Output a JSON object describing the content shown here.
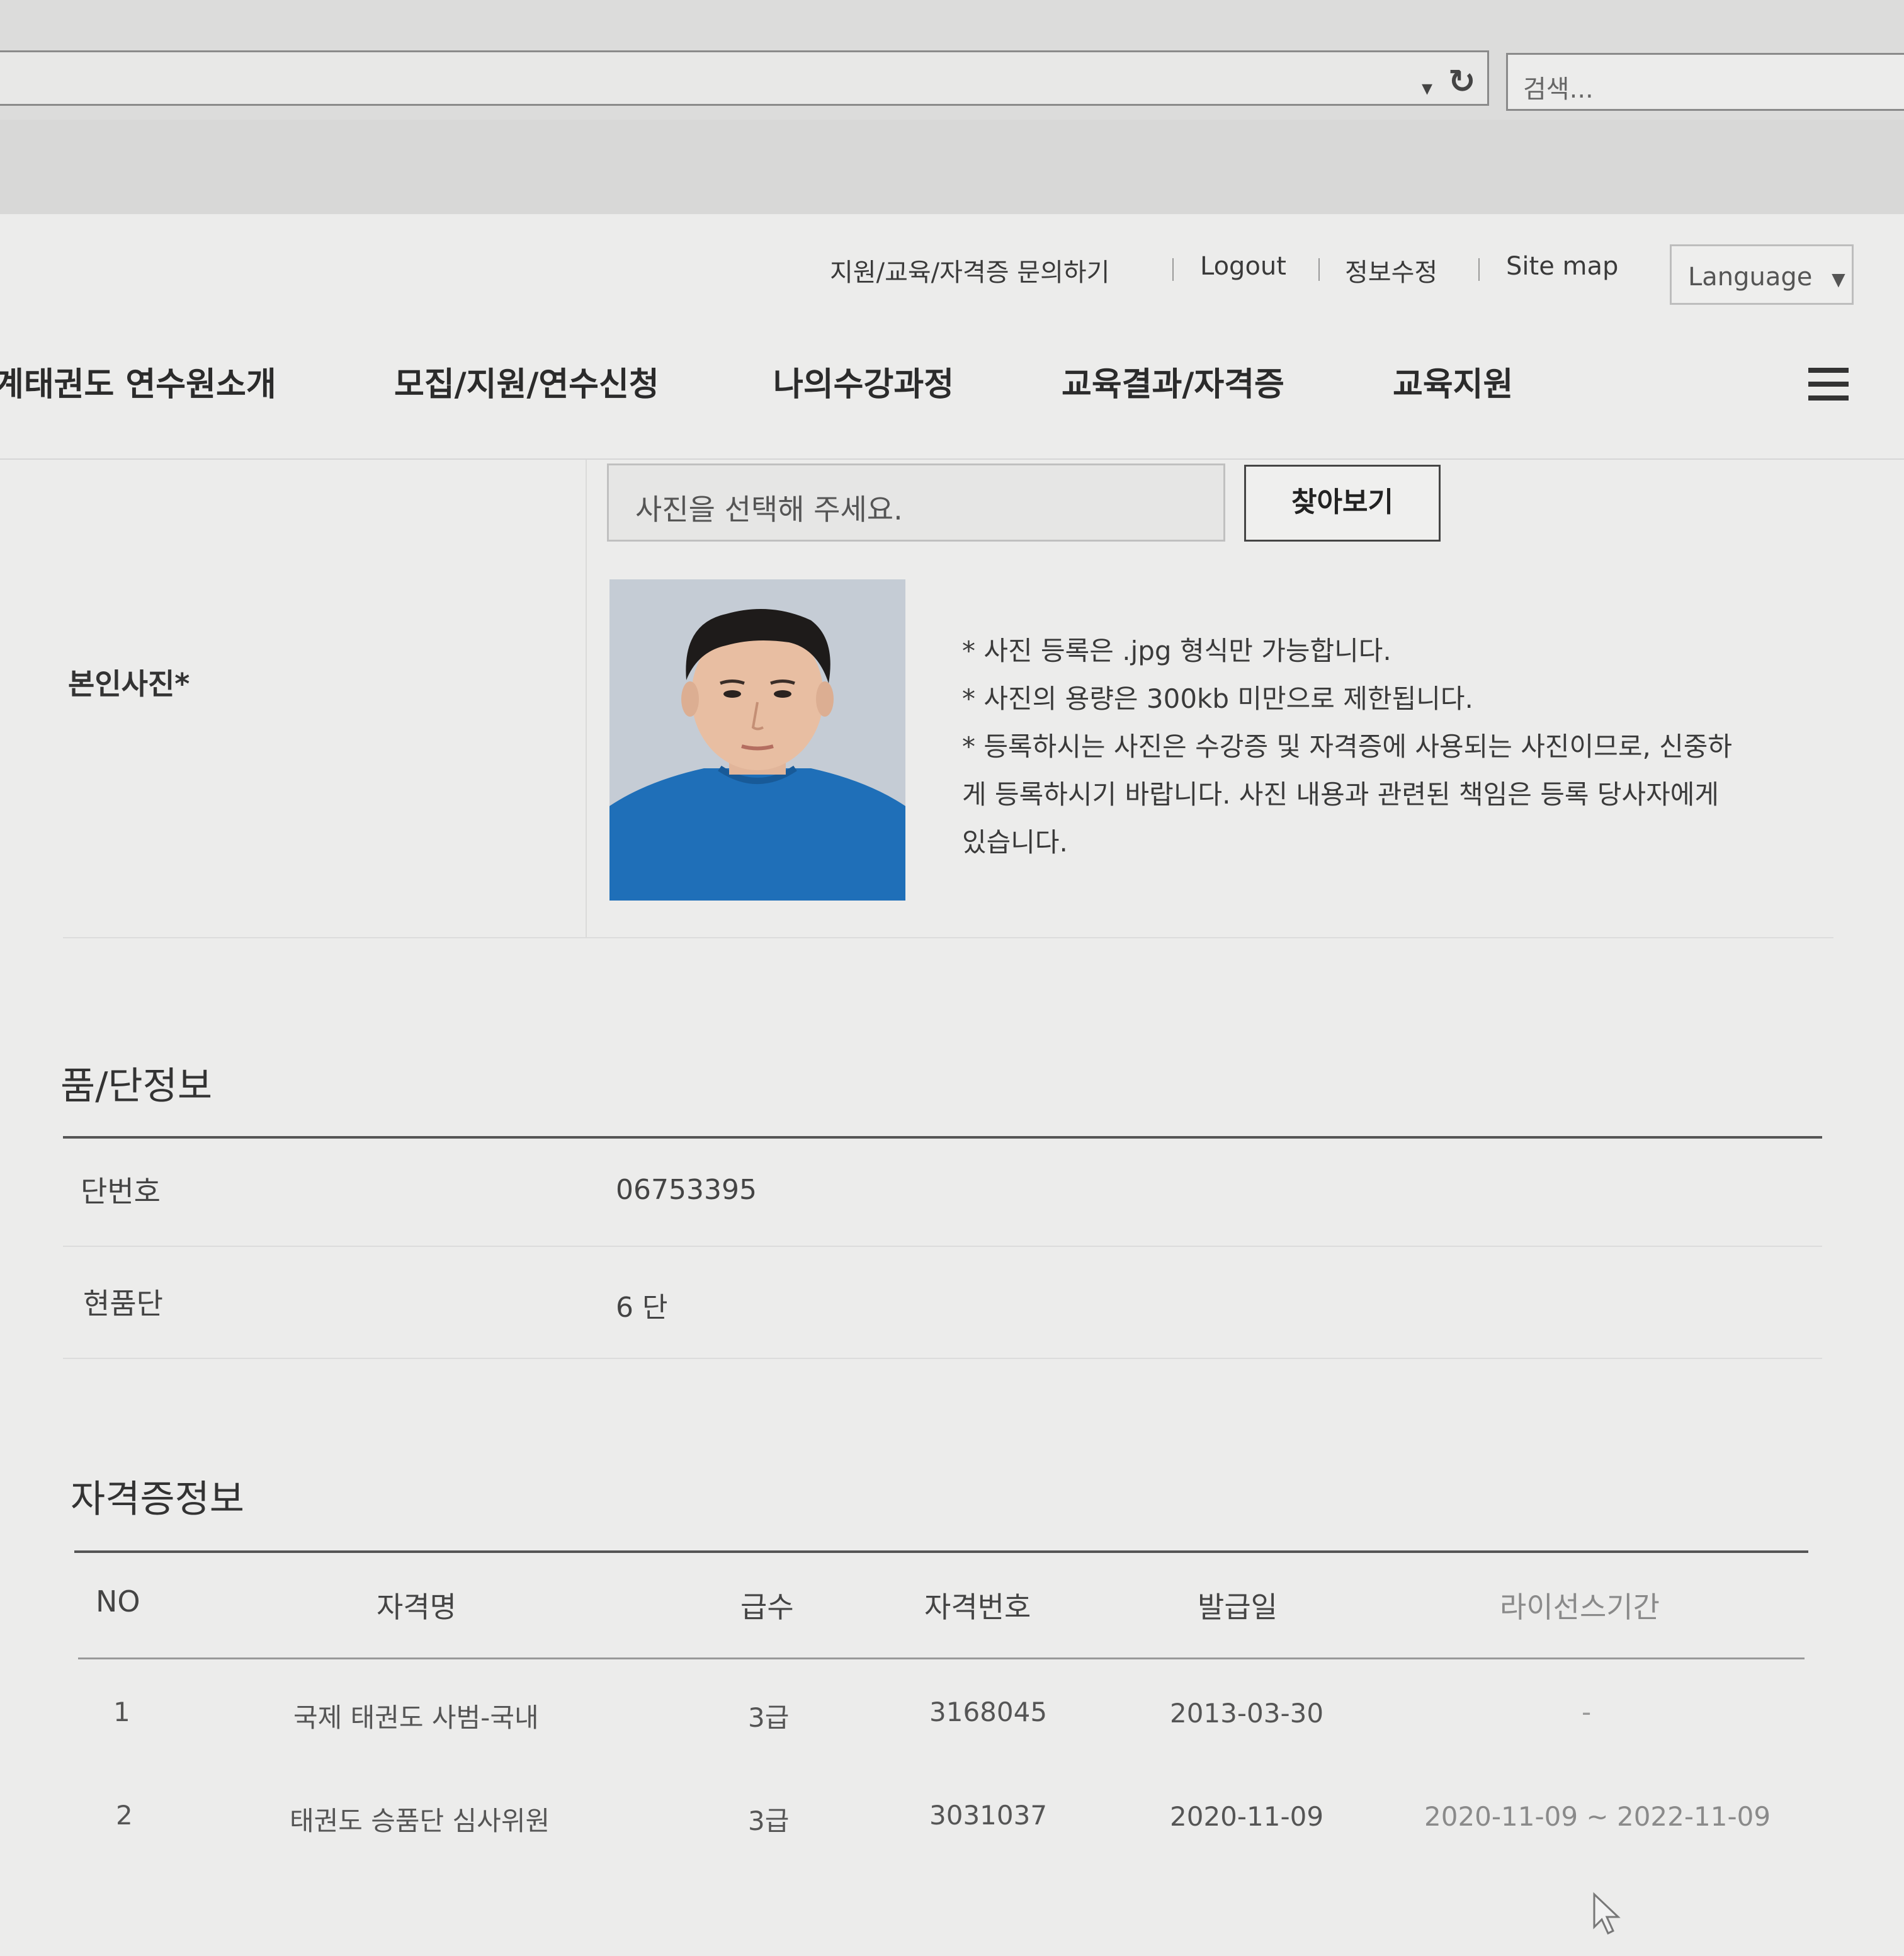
{
  "browser": {
    "search_placeholder": "검색..."
  },
  "utility_nav": {
    "links": [
      {
        "label": "지원/교육/자격증 문의하기"
      },
      {
        "label": "Logout"
      },
      {
        "label": "정보수정"
      },
      {
        "label": "Site map"
      }
    ],
    "language_label": "Language"
  },
  "main_nav": {
    "items": [
      {
        "label": "계태권도 연수원소개"
      },
      {
        "label": "모집/지원/연수신청"
      },
      {
        "label": "나의수강과정"
      },
      {
        "label": "교육결과/자격증"
      },
      {
        "label": "교육지원"
      }
    ]
  },
  "photo_section": {
    "label": "본인사진*",
    "file_placeholder": "사진을 선택해 주세요.",
    "browse_label": "찾아보기",
    "notices": [
      "* 사진 등록은 .jpg 형식만 가능합니다.",
      "* 사진의 용량은 300kb 미만으로 제한됩니다.",
      "* 등록하시는 사진은 수강증 및 자격증에 사용되는 사진이므로, 신중하",
      "게 등록하시기 바랍니다. 사진 내용과 관련된 책임은 등록 당사자에게",
      "있습니다."
    ]
  },
  "dan_info": {
    "title": "품/단정보",
    "rows": [
      {
        "label": "단번호",
        "value": "06753395"
      },
      {
        "label": "현품단",
        "value": "6 단"
      }
    ]
  },
  "certificates": {
    "title": "자격증정보",
    "columns": [
      "NO",
      "자격명",
      "급수",
      "자격번호",
      "발급일",
      "라이선스기간"
    ],
    "rows": [
      {
        "no": "1",
        "name": "국제 태권도 사범-국내",
        "grade": "3급",
        "number": "3168045",
        "issued": "2013-03-30",
        "period": "-"
      },
      {
        "no": "2",
        "name": "태권도 승품단 심사위원",
        "grade": "3급",
        "number": "3031037",
        "issued": "2020-11-09",
        "period": "2020-11-09 ~ 2022-11-09"
      }
    ]
  }
}
